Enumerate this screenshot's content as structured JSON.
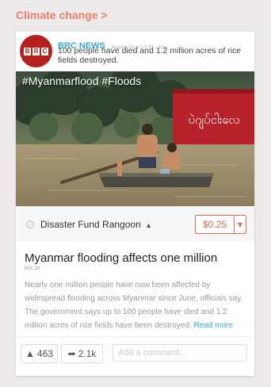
{
  "topic": {
    "label": "Climate change >"
  },
  "source": {
    "name": "BRC NEWS",
    "time": "August 10 at 15:37 · Asia",
    "logo_letters": [
      "B",
      "R",
      "C"
    ]
  },
  "headline": "100 people have died and 1.2 million acres of rice fields destroyed.",
  "photo": {
    "hashtags": "#Myanmarflood #Floods",
    "shop_sign": "ပဲဂျပ်ငါးလေ"
  },
  "fund": {
    "name": "Disaster Fund Rangoon",
    "price": "$0.25"
  },
  "article": {
    "title": "Myanmar flooding affects one million",
    "source": "brc.in",
    "body": "Nearly one million people have now been affected by widespread flooding across Myanmar since June, officials say. The government says up to 100 people have died and 1.2 million acres of rice fields have been destroyed.",
    "read_more": "Read more"
  },
  "actions": {
    "upvote_count": "463",
    "share_count": "2.1k",
    "comment_placeholder": "Add a comment..."
  },
  "colors": {
    "accent": "#e2694a",
    "link": "#3aa8d6",
    "brand": "#b5201c"
  }
}
